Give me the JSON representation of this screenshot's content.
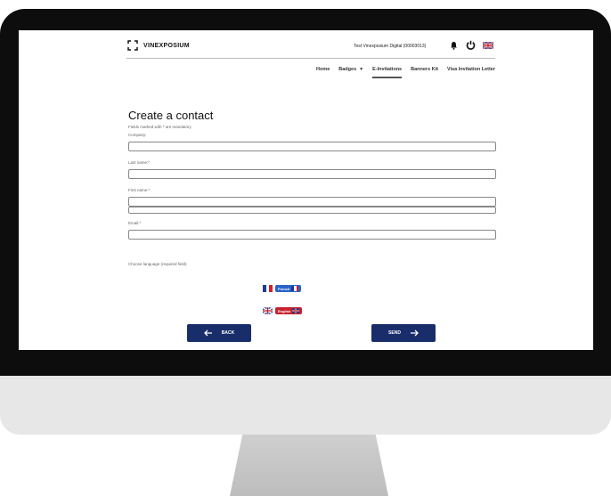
{
  "header": {
    "logo_text": "VINEXPOSIUM",
    "user_name": "Test Vinexposium Digital (00003013)"
  },
  "nav": {
    "items": [
      "Home",
      "Badges",
      "E-Invitations",
      "Banners Kit",
      "Visa Invitation Letter"
    ],
    "active": "E-Invitations"
  },
  "form": {
    "title": "Create a contact",
    "hint": "Fields marked with * are mandatory",
    "company_label": "Company:",
    "lastname_label": "Last name:*",
    "firstname_label": "First name:*",
    "email_label": "Email:*",
    "language_label": "Choose language (required field)"
  },
  "languages": {
    "french": "French",
    "english": "English"
  },
  "buttons": {
    "back": "BACK",
    "send": "SEND"
  },
  "colors": {
    "primary": "#1a2d6b",
    "french_pill": "#2a64c8",
    "english_pill": "#c8202c",
    "bezel": "#0d0d0d",
    "chin": "#e7e7e7"
  }
}
